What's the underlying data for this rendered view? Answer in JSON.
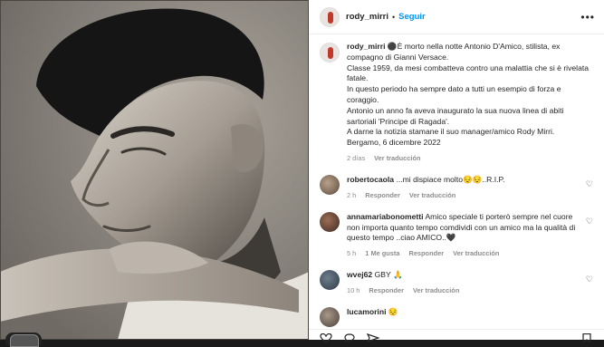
{
  "header": {
    "username": "rody_mirri",
    "separator": "•",
    "follow_label": "Seguir",
    "more_label": "•••"
  },
  "caption": {
    "username": "rody_mirri",
    "lines": [
      "⚫️È morto nella notte Antonio D'Amico, stilista, ex compagno di Gianni Versace.",
      "Classe 1959, da mesi combatteva contro una malattia che si è rivelata fatale.",
      "In questo periodo ha sempre dato a tutti un esempio di forza e coraggio.",
      "Antonio un anno fa aveva inaugurato la sua nuova linea di abiti sartoriali 'Principe di Ragada'.",
      "A darne la notizia stamane il suo manager/amico Rody Mirri.",
      "Bergamo, 6 dicembre 2022"
    ],
    "time": "2 días",
    "translate": "Ver traducción"
  },
  "comments": [
    {
      "username": "robertocaola",
      "text": "...mi dispiace molto😔😔..R.I.P.",
      "time": "2 h",
      "reply": "Responder",
      "translate": "Ver traducción"
    },
    {
      "username": "annamariabonometti",
      "text": "Amico speciale ti porterò sempre nel cuore non importa quanto tempo comdividi con un amico ma la qualità di questo tempo ..ciao AMICO..🖤",
      "time": "5 h",
      "likes": "1 Me gusta",
      "reply": "Responder",
      "translate": "Ver traducción"
    },
    {
      "username": "wvej62",
      "text": "GBY 🙏",
      "time": "10 h",
      "reply": "Responder",
      "translate": "Ver traducción"
    },
    {
      "username": "lucamorini",
      "text": "😔"
    }
  ],
  "colors": {
    "accent": "#0095f6",
    "text": "#262626",
    "muted": "#8e8e8e"
  },
  "icons": [
    "more-options-icon",
    "heart-icon",
    "comment-icon",
    "share-icon",
    "bookmark-icon"
  ]
}
